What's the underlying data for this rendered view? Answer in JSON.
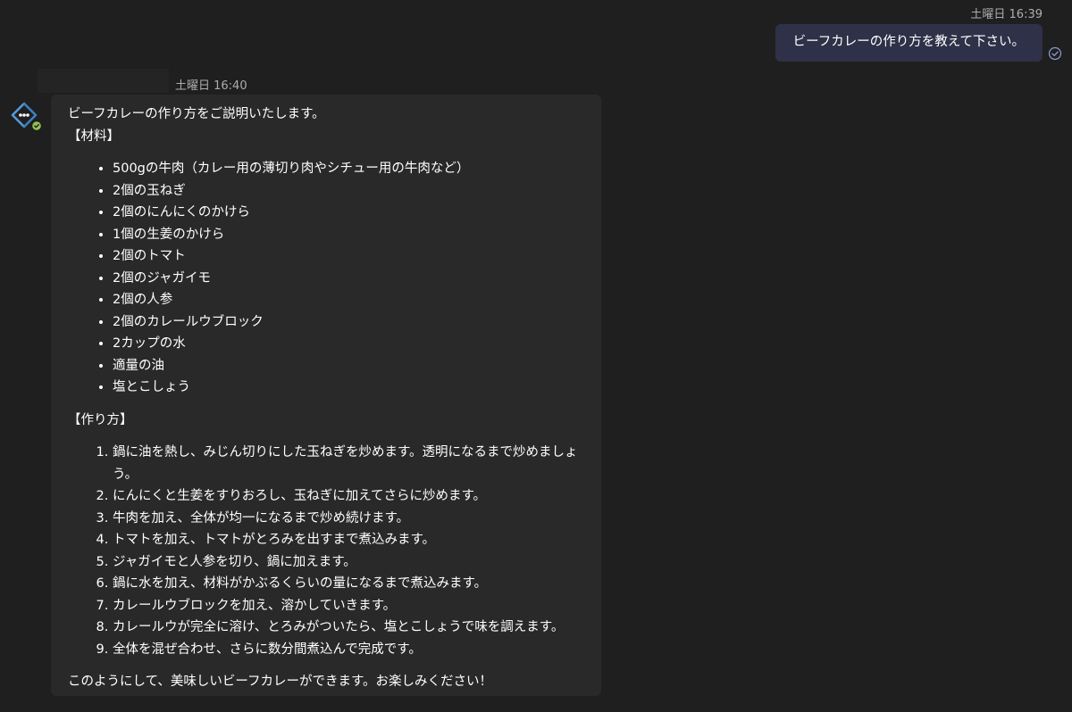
{
  "user_message": {
    "timestamp": "土曜日 16:39",
    "text": "ビーフカレーの作り方を教えて下さい。",
    "status_icon": "read-receipt-check-icon"
  },
  "bot_message": {
    "timestamp": "土曜日 16:40",
    "avatar_icon": "bot-avatar-icon",
    "intro": "ビーフカレーの作り方をご説明いたします。",
    "ingredients_heading": "【材料】",
    "ingredients": [
      "500gの牛肉（カレー用の薄切り肉やシチュー用の牛肉など）",
      "2個の玉ねぎ",
      "2個のにんにくのかけら",
      "1個の生姜のかけら",
      "2個のトマト",
      "2個のジャガイモ",
      "2個の人参",
      "2個のカレールウブロック",
      "2カップの水",
      "適量の油",
      "塩とこしょう"
    ],
    "steps_heading": "【作り方】",
    "steps": [
      "鍋に油を熱し、みじん切りにした玉ねぎを炒めます。透明になるまで炒めましょう。",
      "にんにくと生姜をすりおろし、玉ねぎに加えてさらに炒めます。",
      "牛肉を加え、全体が均一になるまで炒め続けます。",
      "トマトを加え、トマトがとろみを出すまで煮込みます。",
      "ジャガイモと人参を切り、鍋に加えます。",
      "鍋に水を加え、材料がかぶるくらいの量になるまで煮込みます。",
      "カレールウブロックを加え、溶かしていきます。",
      "カレールウが完全に溶け、とろみがついたら、塩とこしょうで味を調えます。",
      "全体を混ぜ合わせ、さらに数分間煮込んで完成です。"
    ],
    "closing": "このようにして、美味しいビーフカレーができます。お楽しみください！"
  },
  "colors": {
    "background": "#1f1f1f",
    "bot_bubble": "#292929",
    "user_bubble": "#2f3148",
    "accent_blue": "#4f9bd9",
    "status_green": "#92c353"
  }
}
